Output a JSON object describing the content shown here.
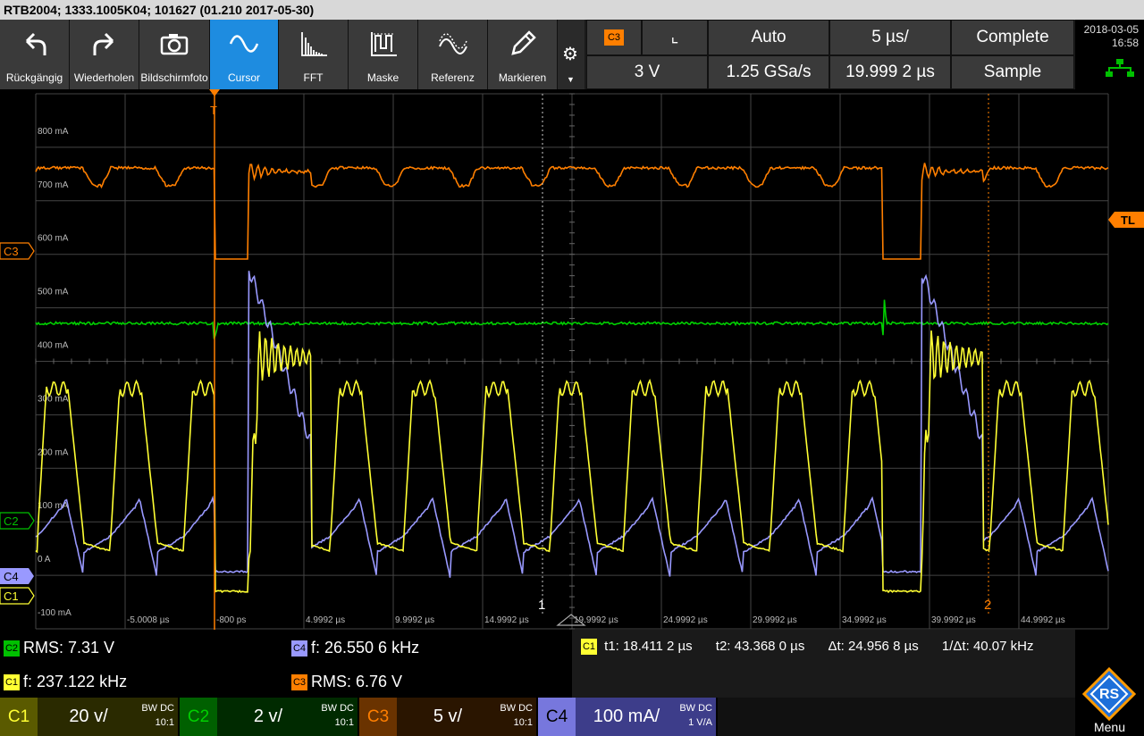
{
  "titlebar": {
    "text": "RTB2004; 1333.1005K04; 101627 (01.210 2017-05-30)"
  },
  "toolbar": {
    "buttons": [
      {
        "label": "Rückgängig",
        "icon": "undo-icon"
      },
      {
        "label": "Wiederholen",
        "icon": "redo-icon"
      },
      {
        "label": "Bildschirmfoto",
        "icon": "camera-icon"
      },
      {
        "label": "Cursor",
        "icon": "cursor-wave-icon",
        "active": true
      },
      {
        "label": "FFT",
        "icon": "fft-icon"
      },
      {
        "label": "Maske",
        "icon": "mask-icon"
      },
      {
        "label": "Referenz",
        "icon": "reference-icon"
      },
      {
        "label": "Markieren",
        "icon": "pencil-icon"
      }
    ]
  },
  "trigger": {
    "source": "C3",
    "slope_icon": "falling-edge-icon",
    "level": "3 V",
    "mode": "Auto",
    "timebase": "5 µs/",
    "sample_rate": "1.25 GSa/s",
    "position": "19.999 2 µs",
    "acq_state": "Complete",
    "acq_mode": "Sample"
  },
  "datetime": {
    "date": "2018-03-05",
    "time": "16:58"
  },
  "grid": {
    "y_labels": [
      "800 mA",
      "700 mA",
      "600 mA",
      "500 mA",
      "400 mA",
      "300 mA",
      "200 mA",
      "100 mA",
      "0 A",
      "-100 mA"
    ],
    "x_labels": [
      "-5.0008 µs",
      "-800 ps",
      "4.9992 µs",
      "9.9992 µs",
      "14.9992 µs",
      "19.9992 µs",
      "24.9992 µs",
      "29.9992 µs",
      "34.9992 µs",
      "39.9992 µs",
      "44.9992 µs"
    ],
    "markers": {
      "c3": "C3",
      "c2": "C2",
      "c4": "C4",
      "c1": "C1",
      "tl": "TL",
      "cursor1": "1",
      "cursor2": "2",
      "trigger": "T"
    }
  },
  "measurements": {
    "c2_rms": {
      "badge": "C2",
      "text": "RMS: 7.31 V"
    },
    "c4_f": {
      "badge": "C4",
      "text": "f: 26.550 6 kHz"
    },
    "c1_f": {
      "badge": "C1",
      "text": "f: 237.122 kHz"
    },
    "c3_rms": {
      "badge": "C3",
      "text": "RMS: 6.76 V"
    },
    "cursor": {
      "badge": "C1",
      "t1": "t1: 18.411 2 µs",
      "t2": "t2: 43.368 0 µs",
      "dt": "Δt: 24.956 8 µs",
      "inv_dt": "1/Δt: 40.07 kHz"
    }
  },
  "channels": [
    {
      "name": "C1",
      "scale": "20 v/",
      "bw": "BW DC",
      "probe": "10:1",
      "color": "#cccc00",
      "tile": "#555500"
    },
    {
      "name": "C2",
      "scale": "2 v/",
      "bw": "BW DC",
      "probe": "10:1",
      "color": "#00b000",
      "tile": "#004400"
    },
    {
      "name": "C3",
      "scale": "5 v/",
      "bw": "BW DC",
      "probe": "10:1",
      "color": "#ff7f00",
      "tile": "#552a00"
    },
    {
      "name": "C4",
      "scale": "100 mA/",
      "bw": "BW DC",
      "probe": "1 V/A",
      "color": "#9999ff",
      "tile": "#2b2b66"
    }
  ],
  "menu_label": "Menu",
  "logo_letters": "RS"
}
